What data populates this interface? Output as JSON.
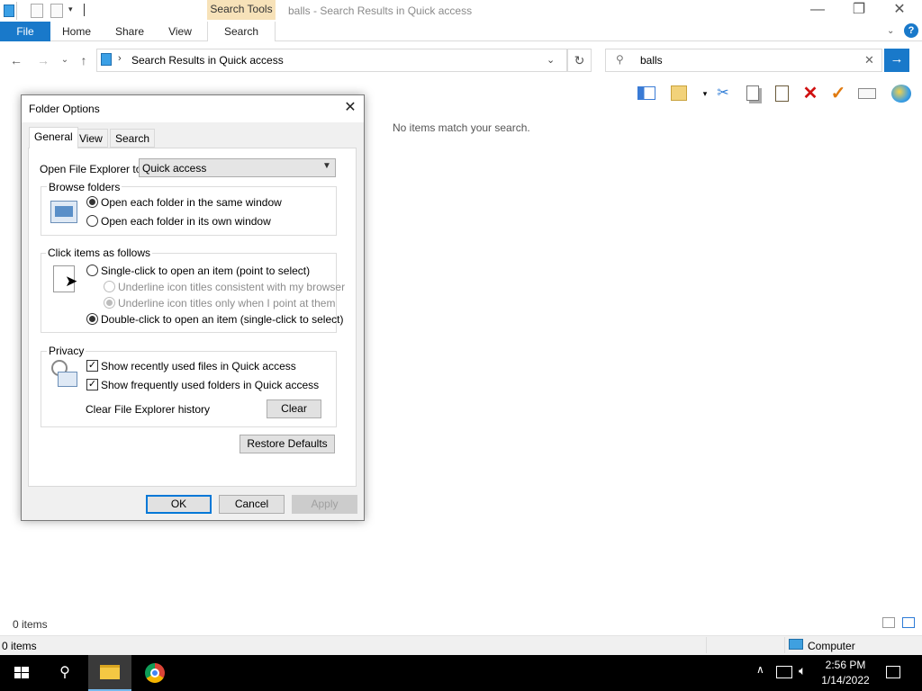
{
  "window": {
    "title": "balls - Search Results in Quick access",
    "context_tab_header": "Search Tools",
    "controls": {
      "minimize": "—",
      "restore": "❐",
      "close": "✕"
    }
  },
  "ribbon": {
    "tabs": [
      "File",
      "Home",
      "Share",
      "View",
      "Search"
    ],
    "help": "?"
  },
  "address": {
    "path": "Search Results in Quick access",
    "refresh": "↻"
  },
  "search": {
    "query": "balls",
    "clear": "✕",
    "go": "→"
  },
  "content": {
    "empty_message": "No items match your search."
  },
  "status": {
    "items_top": "0 items",
    "items_bottom": "0 items",
    "location": "Computer"
  },
  "taskbar": {
    "time": "2:56 PM",
    "date": "1/14/2022"
  },
  "dialog": {
    "title": "Folder Options",
    "tabs": [
      "General",
      "View",
      "Search"
    ],
    "open_to_label": "Open File Explorer to:",
    "open_to_value": "Quick access",
    "browse": {
      "title": "Browse folders",
      "same_window": "Open each folder in the same window",
      "own_window": "Open each folder in its own window"
    },
    "click": {
      "title": "Click items as follows",
      "single": "Single-click to open an item (point to select)",
      "underline_browser": "Underline icon titles consistent with my browser",
      "underline_point": "Underline icon titles only when I point at them",
      "double": "Double-click to open an item (single-click to select)"
    },
    "privacy": {
      "title": "Privacy",
      "recent_files": "Show recently used files in Quick access",
      "frequent_folders": "Show frequently used folders in Quick access",
      "clear_history": "Clear File Explorer history",
      "clear_btn": "Clear"
    },
    "restore_defaults": "Restore Defaults",
    "ok": "OK",
    "cancel": "Cancel",
    "apply": "Apply"
  }
}
